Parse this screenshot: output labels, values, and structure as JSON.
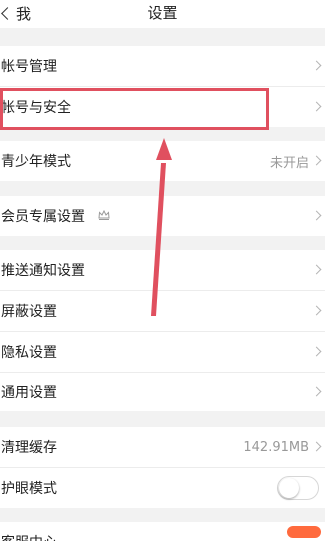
{
  "nav": {
    "back_label": "我",
    "title": "设置"
  },
  "groups": {
    "account": {
      "items": [
        {
          "label": "帐号管理"
        },
        {
          "label": "帐号与安全"
        }
      ]
    },
    "youth": {
      "label": "青少年模式",
      "value": "未开启"
    },
    "vip": {
      "label": "会员专属设置",
      "icon": "crown-icon"
    },
    "general": {
      "items": [
        {
          "label": "推送通知设置"
        },
        {
          "label": "屏蔽设置"
        },
        {
          "label": "隐私设置"
        },
        {
          "label": "通用设置"
        }
      ]
    },
    "storage": {
      "cache_label": "清理缓存",
      "cache_value": "142.91MB",
      "eye_label": "护眼模式",
      "eye_on": false
    },
    "service": {
      "label": "客服中心"
    }
  },
  "annotation": {
    "highlight_target": "帐号与安全",
    "color": "#e0505f"
  }
}
